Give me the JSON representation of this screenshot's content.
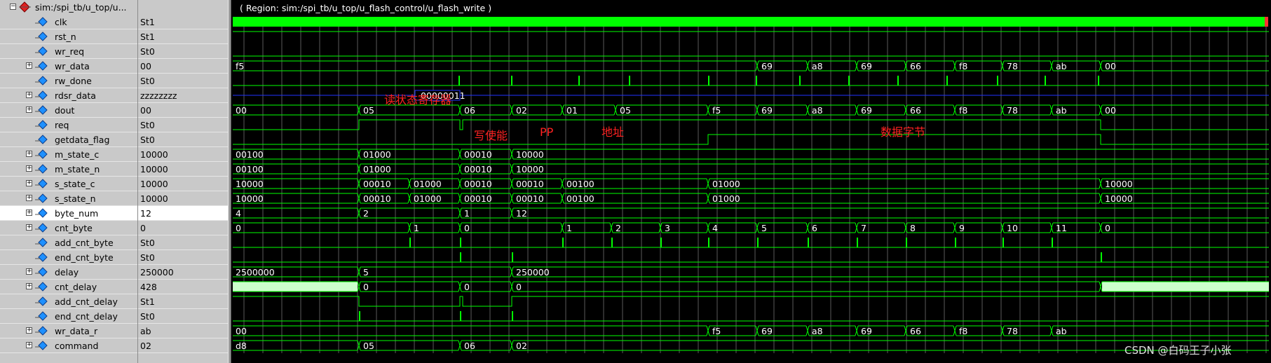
{
  "root": {
    "name": "sim:/spi_tb/u_top/u..."
  },
  "region_label": "( Region: sim:/spi_tb/u_top/u_flash_control/u_flash_write )",
  "signals": [
    {
      "name": "clk",
      "value": "St1",
      "bus": false
    },
    {
      "name": "rst_n",
      "value": "St1",
      "bus": false
    },
    {
      "name": "wr_req",
      "value": "St0",
      "bus": false
    },
    {
      "name": "wr_data",
      "value": "00",
      "bus": true
    },
    {
      "name": "rw_done",
      "value": "St0",
      "bus": false
    },
    {
      "name": "rdsr_data",
      "value": "zzzzzzzz",
      "bus": true
    },
    {
      "name": "dout",
      "value": "00",
      "bus": true
    },
    {
      "name": "req",
      "value": "St0",
      "bus": false
    },
    {
      "name": "getdata_flag",
      "value": "St0",
      "bus": false
    },
    {
      "name": "m_state_c",
      "value": "10000",
      "bus": true
    },
    {
      "name": "m_state_n",
      "value": "10000",
      "bus": true
    },
    {
      "name": "s_state_c",
      "value": "10000",
      "bus": true
    },
    {
      "name": "s_state_n",
      "value": "10000",
      "bus": true
    },
    {
      "name": "byte_num",
      "value": "12",
      "bus": true,
      "selected": true
    },
    {
      "name": "cnt_byte",
      "value": "0",
      "bus": true
    },
    {
      "name": "add_cnt_byte",
      "value": "St0",
      "bus": false
    },
    {
      "name": "end_cnt_byte",
      "value": "St0",
      "bus": false
    },
    {
      "name": "delay",
      "value": "250000",
      "bus": true
    },
    {
      "name": "cnt_delay",
      "value": "428",
      "bus": true
    },
    {
      "name": "add_cnt_delay",
      "value": "St1",
      "bus": false
    },
    {
      "name": "end_cnt_delay",
      "value": "St0",
      "bus": false
    },
    {
      "name": "wr_data_r",
      "value": "ab",
      "bus": true
    },
    {
      "name": "command",
      "value": "02",
      "bus": true
    }
  ],
  "wave_labels": {
    "wr_data": [
      "f5",
      "69",
      "a8",
      "69",
      "66",
      "f8",
      "78",
      "ab",
      "00"
    ],
    "rdsr_data": [
      "00000011"
    ],
    "dout": [
      "00",
      "05",
      "06",
      "02",
      "01",
      "05",
      "f5",
      "69",
      "a8",
      "69",
      "66",
      "f8",
      "78",
      "ab",
      "00"
    ],
    "m_state_c": [
      "00100",
      "01000",
      "00010",
      "10000"
    ],
    "m_state_n": [
      "00100",
      "01000",
      "00010",
      "10000"
    ],
    "s_state_c": [
      "10000",
      "00010",
      "01000",
      "00010",
      "00010",
      "00100",
      "01000",
      "10000"
    ],
    "s_state_n": [
      "10000",
      "00010",
      "01000",
      "00010",
      "00010",
      "00100",
      "01000",
      "10000"
    ],
    "byte_num": [
      "4",
      "2",
      "1",
      "12"
    ],
    "cnt_byte": [
      "0",
      "1",
      "0",
      "1",
      "2",
      "3",
      "4",
      "5",
      "6",
      "7",
      "8",
      "9",
      "10",
      "11",
      "0"
    ],
    "delay": [
      "2500000",
      "5",
      "250000"
    ],
    "cnt_delay": [
      "0",
      "0",
      "0"
    ],
    "wr_data_r": [
      "00",
      "f5",
      "69",
      "a8",
      "69",
      "66",
      "f8",
      "78",
      "ab"
    ],
    "command": [
      "d8",
      "05",
      "06",
      "02"
    ]
  },
  "annotations": [
    "读状态寄存器",
    "写使能",
    "PP",
    "地址",
    "数据字节"
  ],
  "watermark": "CSDN @白码王子小张",
  "colors": {
    "wave": "#00ff00",
    "hiz": "#2233ff",
    "bus_fill": "#ccffcc",
    "annotation": "#ff2222",
    "panel": "#c9c9c9"
  }
}
